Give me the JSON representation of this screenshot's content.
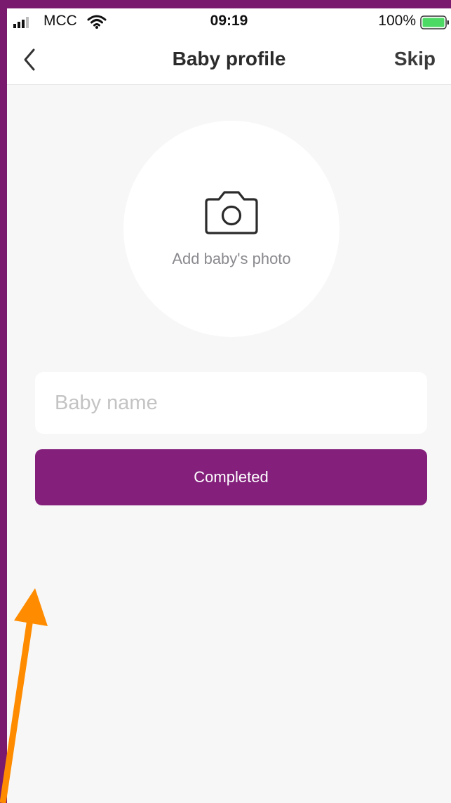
{
  "status_bar": {
    "carrier": "MCC",
    "time": "09:19",
    "battery": "100%",
    "signal_icon": "cellular-signal-icon",
    "wifi_icon": "wifi-icon",
    "battery_icon": "battery-icon",
    "battery_color": "#4cd964"
  },
  "nav": {
    "back_icon": "chevron-left-icon",
    "title": "Baby profile",
    "skip_label": "Skip"
  },
  "photo": {
    "icon": "camera-icon",
    "label": "Add baby's photo"
  },
  "form": {
    "name_value": "",
    "name_placeholder": "Baby name",
    "submit_label": "Completed"
  },
  "colors": {
    "accent": "#84207c",
    "frame": "#7a1a6e",
    "background": "#f7f7f7",
    "annotation_arrow": "#ff8c00"
  }
}
